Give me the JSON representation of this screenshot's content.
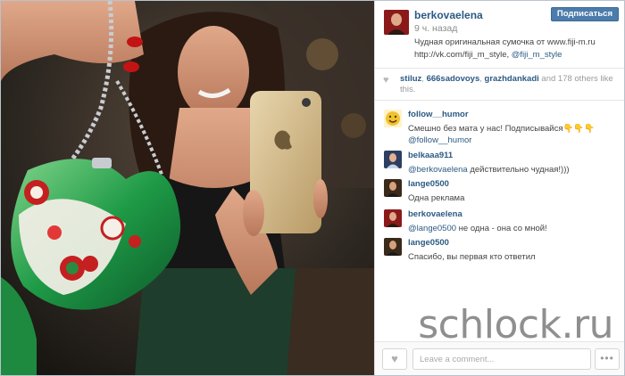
{
  "post": {
    "username": "berkovaelena",
    "follow_label": "Подписаться",
    "time": "9 ч. назад",
    "caption_line1": "Чудная оригинальная сумочка от www.fiji-m.ru",
    "caption_line2": "http://vk.com/fiji_m_style,",
    "caption_mention": "@fiji_m_style"
  },
  "likes": {
    "user1": "stiluz",
    "user2": "666sadovoys",
    "user3": "grazhdankadi",
    "sep1": ", ",
    "sep2": ", ",
    "rest": " and 178 others like this."
  },
  "comments": [
    {
      "user": "follow__humor",
      "text": "Смешно без мата у нас! Подписывайся👇👇👇",
      "mention": "@follow__humor",
      "after": ""
    },
    {
      "user": "belkaaa911",
      "text": "",
      "mention": "@berkovaelena",
      "after": " действительно чудная!)))"
    },
    {
      "user": "lange0500",
      "text": "Одна реклама",
      "mention": "",
      "after": ""
    },
    {
      "user": "berkovaelena",
      "text": "",
      "mention": "@lange0500",
      "after": " не одна - она со мной!"
    },
    {
      "user": "lange0500",
      "text": "Спасибо, вы первая кто ответил",
      "mention": "",
      "after": ""
    }
  ],
  "composer": {
    "placeholder": "Leave a comment...",
    "more_label": "•••"
  },
  "watermark": "schlock.ru",
  "icons": {
    "heart": "heart-icon",
    "more": "more-options-icon"
  },
  "colors": {
    "link": "#2b5a83",
    "follow_button": "#4b7cab"
  }
}
